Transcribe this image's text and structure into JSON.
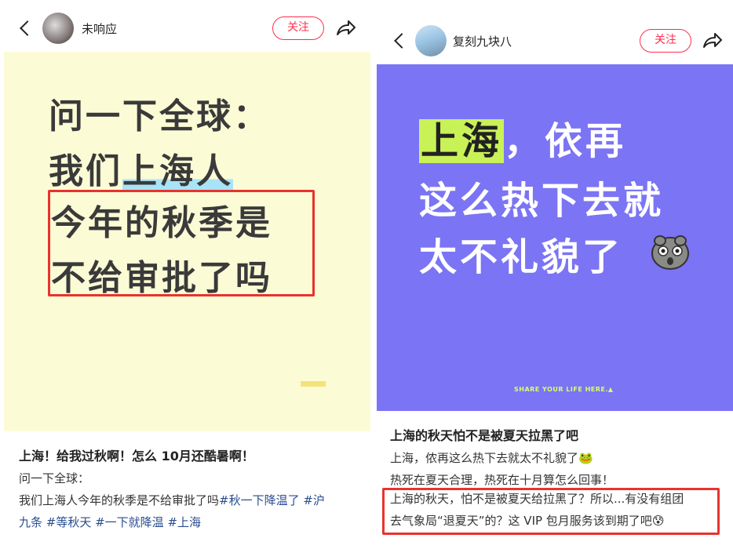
{
  "left": {
    "username": "未响应",
    "follow_label": "关注",
    "cover": {
      "line1": "问一下全球：",
      "line2_prefix": "我们",
      "line2_highlight": "上海人",
      "line3": "今年的秋季是",
      "line4": "不给审批了吗"
    },
    "title": "上海！给我过秋啊！怎么 10月还酷暑啊！",
    "body": {
      "line1": "问一下全球：",
      "line2_text": "我们上海人今年的秋季是不给审批了吗",
      "tags_line2": "#秋一下降温了 #沪",
      "tags_line3": "九条 #等秋天 #一下就降温 #上海"
    }
  },
  "right": {
    "username": "复刻九块八",
    "follow_label": "关注",
    "cover": {
      "line1_highlight": "上海",
      "line1_rest": "，依再",
      "line2": "这么热下去就",
      "line3": "太不礼貌了",
      "footer": "SHARE YOUR LIFE HERE.▲"
    },
    "title": "上海的秋天怕不是被夏天拉黑了吧",
    "body": {
      "line1": "上海，侬再这么热下去就太不礼貌了",
      "line2": "热死在夏天合理，热死在十月算怎么回事！",
      "line3": "上海的秋天，怕不是被夏天给拉黑了？所以...有没有组团",
      "line4": "去气象局“退夏天”的？这 VIP 包月服务该到期了吧"
    }
  },
  "icons": {
    "back": "back-icon",
    "share": "share-icon",
    "emoji": "frog-face-icon"
  },
  "colors": {
    "accent": "#ff2e4d",
    "left_cover_bg": "#fbfbd6",
    "right_cover_bg": "#7b74f4",
    "highlight_box": "#e8332d",
    "tag": "#2a4d8f"
  }
}
